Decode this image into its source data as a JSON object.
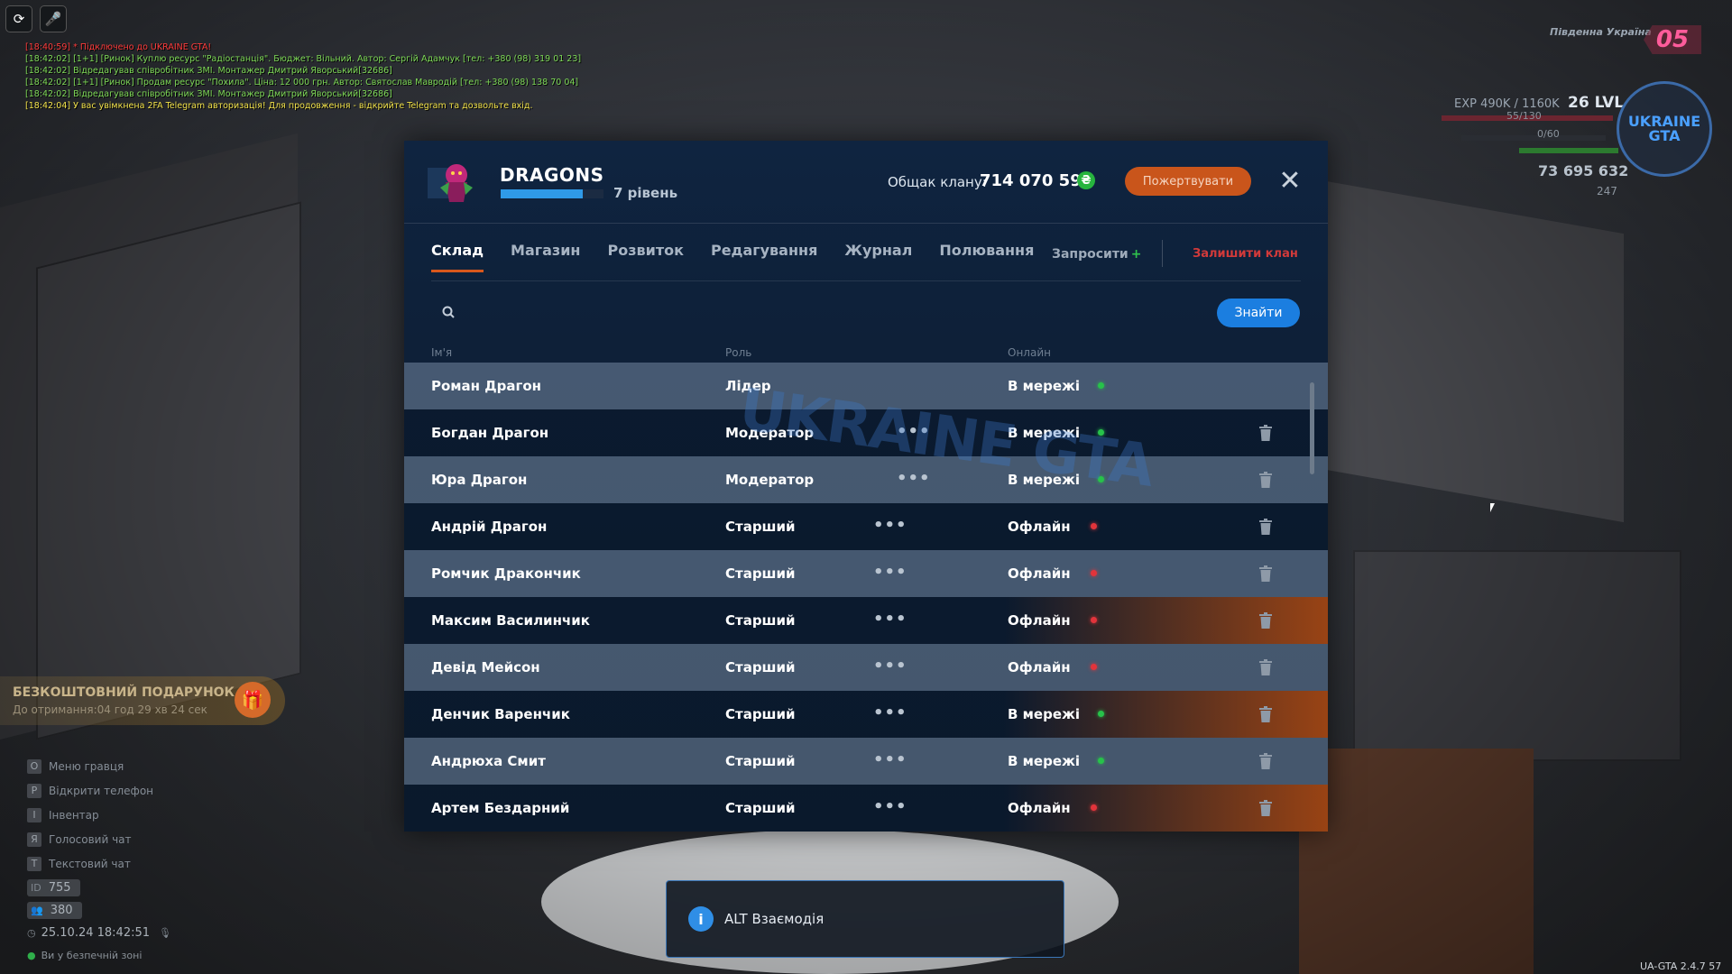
{
  "chat": [
    {
      "text": "[18:40:59] * Підключено до UKRAINE GTA!",
      "color": "#ff3b3b"
    },
    {
      "text": "[18:42:02] [1+1] [Ринок] Куплю ресурс \"Радіостанція\". Бюджет: Вільний. Автор: Сергій Адамчук [тел: +380 (98) 319 01 23]",
      "color": "#7ed957"
    },
    {
      "text": "[18:42:02] Відредагував співробітник ЗМІ. Монтажер Дмитрий Яворський[32686]",
      "color": "#7ed957"
    },
    {
      "text": "[18:42:02] [1+1] [Ринок] Продам ресурс \"Похила\". Ціна: 12 000 грн. Автор: Святослав Мавродій [тел: +380 (98) 138 70 04]",
      "color": "#7ed957"
    },
    {
      "text": "[18:42:02] Відредагував співробітник ЗМІ. Монтажер Дмитрий Яворський[32686]",
      "color": "#7ed957"
    },
    {
      "text": "[18:42:04] У вас увімкнена 2FA Telegram авторизація! Для продовження - відкрийте Telegram та дозвольте вхід.",
      "color": "#f2e24a"
    }
  ],
  "clan": {
    "name": "DRAGONS",
    "level_text": "7 рівень",
    "level_progress": 0.8,
    "total_label": "Общак клану:",
    "total_value": "714 070 594",
    "coin_symbol": "₴",
    "donate_label": "Пожертвувати",
    "close_symbol": "✕"
  },
  "tabs": [
    {
      "label": "Склад",
      "active": true
    },
    {
      "label": "Магазин",
      "active": false
    },
    {
      "label": "Розвиток",
      "active": false
    },
    {
      "label": "Редагування",
      "active": false
    },
    {
      "label": "Журнал",
      "active": false
    },
    {
      "label": "Полювання",
      "active": false
    }
  ],
  "actions": {
    "invite_label": "Запросити",
    "invite_plus": "+",
    "leave_label": "Залишити клан"
  },
  "search": {
    "placeholder": "",
    "button_label": "Знайти"
  },
  "columns": {
    "name": "Ім'я",
    "role": "Роль",
    "online": "Онлайн"
  },
  "members": [
    {
      "name": "Роман Драгон",
      "role": "Лідер",
      "menu": false,
      "status": "В мережі",
      "online": true,
      "deletable": false,
      "style": "light"
    },
    {
      "name": "Богдан Драгон",
      "role": "Модератор",
      "menu": true,
      "status": "В мережі",
      "online": true,
      "deletable": true,
      "style": "dark"
    },
    {
      "name": "Юра Драгон",
      "role": "Модератор",
      "menu": true,
      "status": "В мережі",
      "online": true,
      "deletable": true,
      "style": "light"
    },
    {
      "name": "Андрій Драгон",
      "role": "Старший",
      "menu": true,
      "status": "Офлайн",
      "online": false,
      "deletable": true,
      "style": "dark"
    },
    {
      "name": "Ромчик Дракончик",
      "role": "Старший",
      "menu": true,
      "status": "Офлайн",
      "online": false,
      "deletable": true,
      "style": "light"
    },
    {
      "name": "Максим Василинчик",
      "role": "Старший",
      "menu": true,
      "status": "Офлайн",
      "online": false,
      "deletable": true,
      "style": "accent"
    },
    {
      "name": "Девід Мейсон",
      "role": "Старший",
      "menu": true,
      "status": "Офлайн",
      "online": false,
      "deletable": true,
      "style": "light"
    },
    {
      "name": "Денчик Варенчик",
      "role": "Старший",
      "menu": true,
      "status": "В мережі",
      "online": true,
      "deletable": true,
      "style": "accent"
    },
    {
      "name": "Андрюха Смит",
      "role": "Старший",
      "menu": true,
      "status": "В мережі",
      "online": true,
      "deletable": true,
      "style": "light"
    },
    {
      "name": "Артем Бездарний",
      "role": "Старший",
      "menu": true,
      "status": "Офлайн",
      "online": false,
      "deletable": true,
      "style": "accent"
    }
  ],
  "hud": {
    "region": "Південна Україна",
    "region_number": "05",
    "exp_text": "EXP 490K / 1160K",
    "level_text": "26 LVL",
    "stat1": "55/130",
    "stat2": "0/60",
    "money": "73 695 632",
    "coins": "247",
    "logo_text": "UKRAINE GTA"
  },
  "gift": {
    "title": "БЕЗКОШТОВНИЙ ПОДАРУНОК",
    "subtitle": "До отримання:04 год 29 хв 24 сек"
  },
  "hotkeys": [
    {
      "key": "O",
      "label": "Меню гравця"
    },
    {
      "key": "P",
      "label": "Відкрити телефон"
    },
    {
      "key": "I",
      "label": "Інвентар"
    },
    {
      "key": "Я",
      "label": "Голосовий чат"
    },
    {
      "key": "T",
      "label": "Текстовий чат"
    }
  ],
  "player": {
    "id_label": "ID",
    "id": "755",
    "online": "380",
    "datetime": "25.10.24 18:42:51",
    "zone": "Ви у безпечній зоні"
  },
  "hint": {
    "icon": "i",
    "text": "ALT Взаємодія"
  },
  "version": "UA-GTA 2.4.7   57",
  "watermark": "UKRAINE GTA"
}
